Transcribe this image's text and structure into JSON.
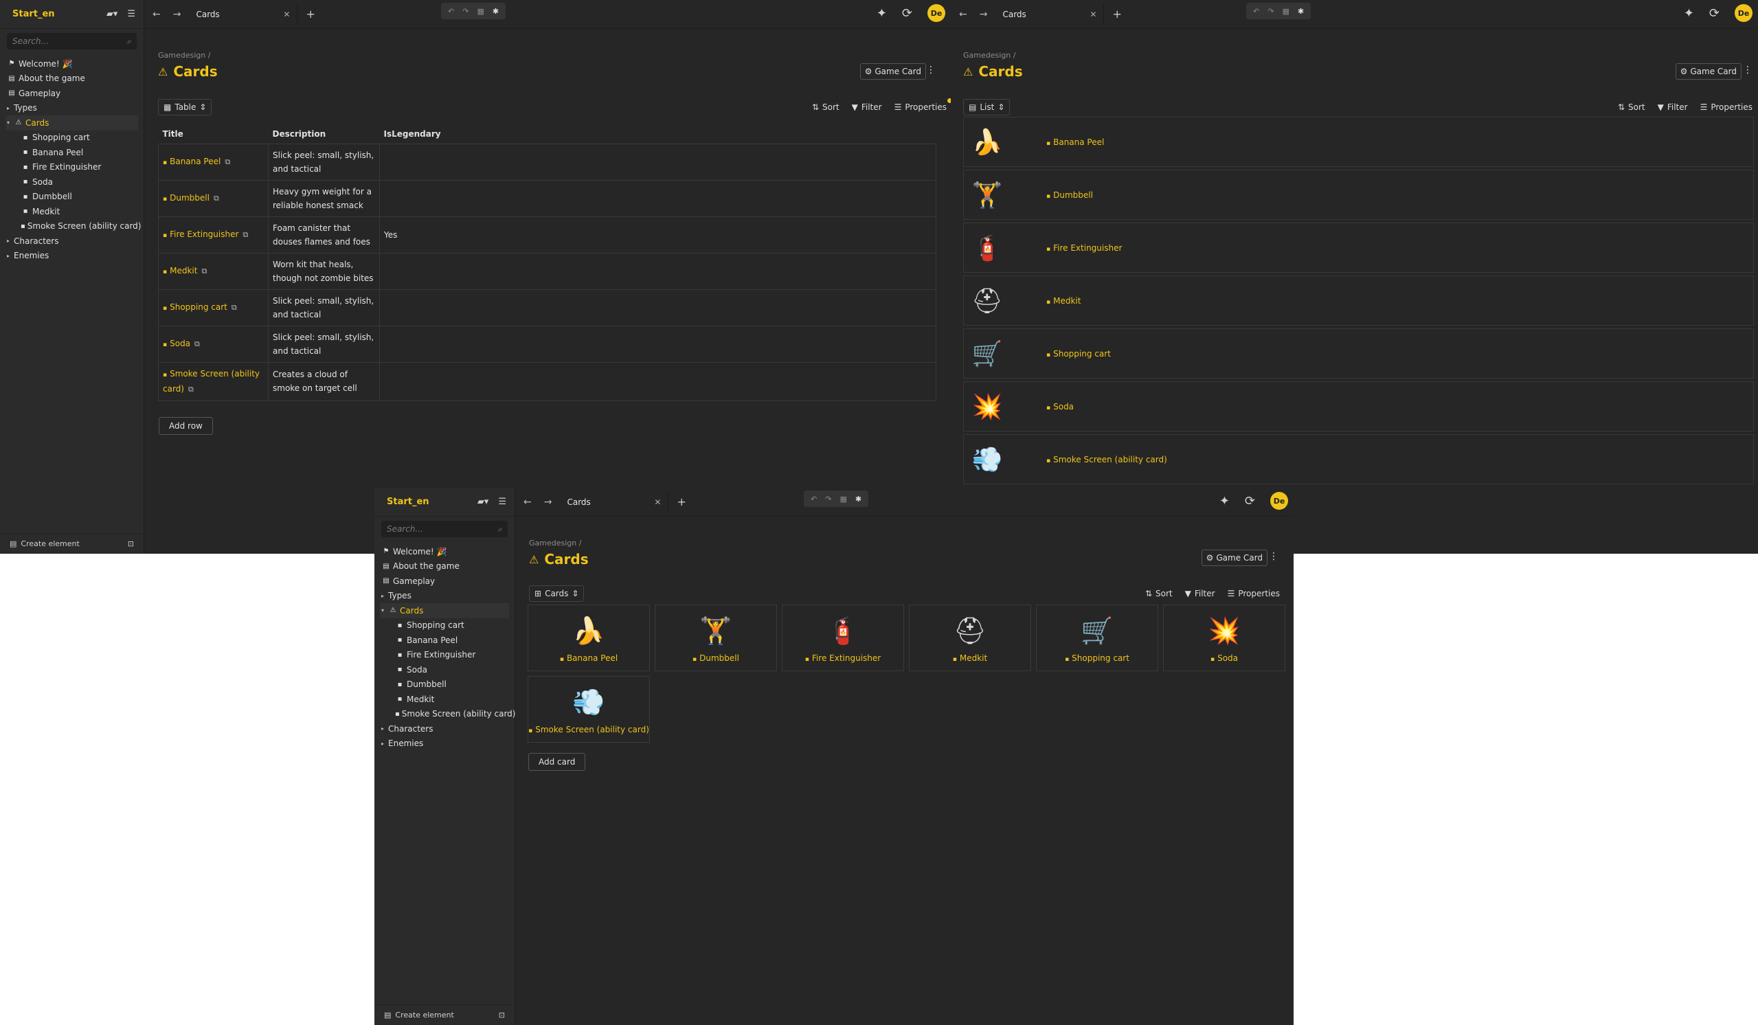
{
  "app": {
    "workspace": "Start_en",
    "search_placeholder": "Search...",
    "tab_title": "Cards",
    "avatar": "De",
    "create_element": "Create element"
  },
  "tree": [
    {
      "label": "Welcome! 🎉",
      "level": 1,
      "icon": "⚑"
    },
    {
      "label": "About the game",
      "level": 1,
      "icon": "▤"
    },
    {
      "label": "Gameplay",
      "level": 1,
      "icon": "▤"
    },
    {
      "label": "Types",
      "level": 1,
      "caret": "▸"
    },
    {
      "label": "Cards",
      "level": 1,
      "caret": "▾",
      "active": true,
      "icon": "⚠"
    },
    {
      "label": "Shopping cart",
      "level": 3,
      "icon": "▪"
    },
    {
      "label": "Banana Peel",
      "level": 3,
      "icon": "▪"
    },
    {
      "label": "Fire Extinguisher",
      "level": 3,
      "icon": "▪"
    },
    {
      "label": "Soda",
      "level": 3,
      "icon": "▪"
    },
    {
      "label": "Dumbbell",
      "level": 3,
      "icon": "▪"
    },
    {
      "label": "Medkit",
      "level": 3,
      "icon": "▪"
    },
    {
      "label": "Smoke Screen (ability card)",
      "level": 3,
      "icon": "▪"
    },
    {
      "label": "Characters",
      "level": 1,
      "caret": "▸"
    },
    {
      "label": "Enemies",
      "level": 1,
      "caret": "▸"
    }
  ],
  "page": {
    "breadcrumb": "Gamedesign /",
    "title": "Cards",
    "game_card_label": "Game Card",
    "sort": "Sort",
    "filter": "Filter",
    "properties": "Properties"
  },
  "table_view": {
    "view_label": "Table",
    "columns": [
      "Title",
      "Description",
      "IsLegendary"
    ],
    "rows": [
      {
        "title": "Banana Peel",
        "desc": "Slick peel: small, stylish, and tactical",
        "legendary": ""
      },
      {
        "title": "Dumbbell",
        "desc": "Heavy gym weight for a reliable honest smack",
        "legendary": ""
      },
      {
        "title": "Fire Extinguisher",
        "desc": "Foam canister that douses flames and foes",
        "legendary": "Yes"
      },
      {
        "title": "Medkit",
        "desc": "Worn kit that heals, though not zombie bites",
        "legendary": ""
      },
      {
        "title": "Shopping cart",
        "desc": "Slick peel: small, stylish, and tactical",
        "legendary": ""
      },
      {
        "title": "Soda",
        "desc": "Slick peel: small, stylish, and tactical",
        "legendary": ""
      },
      {
        "title": "Smoke Screen (ability card)",
        "desc": "Creates a cloud of smoke on target cell",
        "legendary": ""
      }
    ],
    "add_row": "Add row"
  },
  "list_view": {
    "view_label": "List",
    "items": [
      {
        "name": "Banana Peel",
        "thumb": "🍌"
      },
      {
        "name": "Dumbbell",
        "thumb": "🏋"
      },
      {
        "name": "Fire Extinguisher",
        "thumb": "🧯"
      },
      {
        "name": "Medkit",
        "thumb": "⛑"
      },
      {
        "name": "Shopping cart",
        "thumb": "🛒"
      },
      {
        "name": "Soda",
        "thumb": "💥"
      },
      {
        "name": "Smoke Screen (ability card)",
        "thumb": "💨"
      }
    ]
  },
  "gallery_view": {
    "view_label": "Cards",
    "items": [
      {
        "name": "Banana Peel",
        "thumb": "🍌"
      },
      {
        "name": "Dumbbell",
        "thumb": "🏋"
      },
      {
        "name": "Fire Extinguisher",
        "thumb": "🧯"
      },
      {
        "name": "Medkit",
        "thumb": "⛑"
      },
      {
        "name": "Shopping cart",
        "thumb": "🛒"
      },
      {
        "name": "Soda",
        "thumb": "💥"
      },
      {
        "name": "Smoke Screen (ability card)",
        "thumb": "💨"
      }
    ],
    "add_card": "Add card"
  },
  "colors": {
    "accent": "#f0c419",
    "bg": "#262626",
    "sidebar": "#2b2b2b"
  }
}
